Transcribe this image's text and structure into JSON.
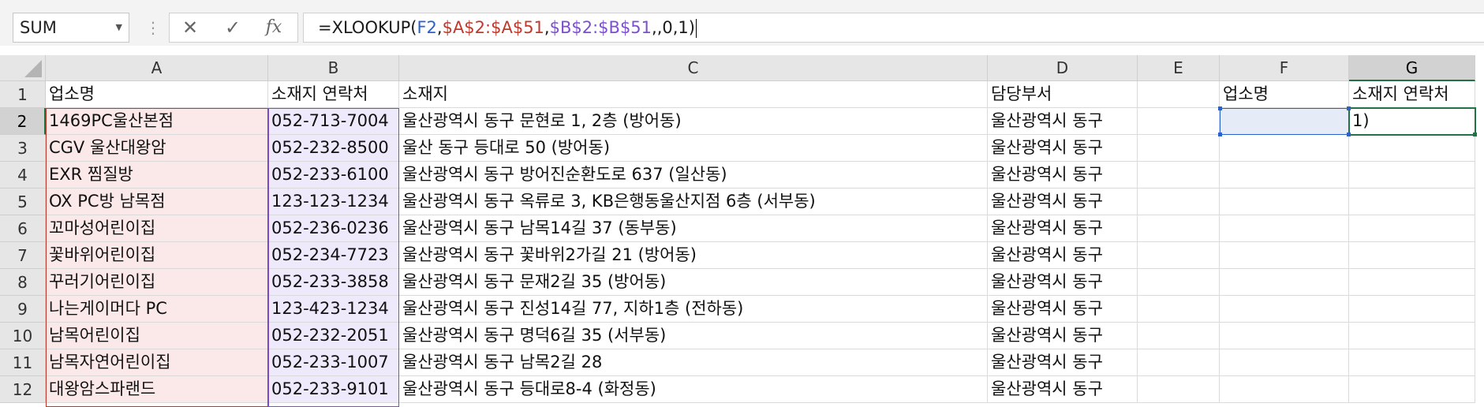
{
  "formula_bar": {
    "name_box": "SUM",
    "cancel_icon": "✕",
    "enter_icon": "✓",
    "fx_label": "fx",
    "formula_parts": [
      {
        "text": "=XLOOKUP(",
        "color": "#1a1a1a"
      },
      {
        "text": "F2",
        "color": "#2a62c9"
      },
      {
        "text": ",",
        "color": "#1a1a1a"
      },
      {
        "text": "$A$2:$A$51",
        "color": "#c0392b"
      },
      {
        "text": ",",
        "color": "#1a1a1a"
      },
      {
        "text": "$B$2:$B$51",
        "color": "#7d4fd0"
      },
      {
        "text": ",,0,1)",
        "color": "#1a1a1a"
      }
    ]
  },
  "columns": [
    "A",
    "B",
    "C",
    "D",
    "E",
    "F",
    "G"
  ],
  "selected_column": "G",
  "rows": [
    {
      "num": "1",
      "A": "업소명",
      "B": "소재지 연락처",
      "C": "소재지",
      "D": "담당부서",
      "E": "",
      "F": "업소명",
      "G": "소재지 연락처"
    },
    {
      "num": "2",
      "A": "1469PC울산본점",
      "B": "052-713-7004",
      "C": "울산광역시 동구 문현로 1, 2층 (방어동)",
      "D": "울산광역시 동구",
      "E": "",
      "F": "",
      "G": "1)"
    },
    {
      "num": "3",
      "A": "CGV 울산대왕암",
      "B": "052-232-8500",
      "C": "울산 동구 등대로 50 (방어동)",
      "D": "울산광역시 동구",
      "E": "",
      "F": "",
      "G": ""
    },
    {
      "num": "4",
      "A": "EXR 찜질방",
      "B": "052-233-6100",
      "C": "울산광역시 동구 방어진순환도로 637 (일산동)",
      "D": "울산광역시 동구",
      "E": "",
      "F": "",
      "G": ""
    },
    {
      "num": "5",
      "A": "OX PC방 남목점",
      "B": "123-123-1234",
      "C": "울산광역시 동구 옥류로 3, KB은행동울산지점 6층 (서부동)",
      "D": "울산광역시 동구",
      "E": "",
      "F": "",
      "G": ""
    },
    {
      "num": "6",
      "A": "꼬마성어린이집",
      "B": "052-236-0236",
      "C": "울산광역시 동구 남목14길 37 (동부동)",
      "D": "울산광역시 동구",
      "E": "",
      "F": "",
      "G": ""
    },
    {
      "num": "7",
      "A": "꽃바위어린이집",
      "B": "052-234-7723",
      "C": "울산광역시 동구 꽃바위2가길 21 (방어동)",
      "D": "울산광역시 동구",
      "E": "",
      "F": "",
      "G": ""
    },
    {
      "num": "8",
      "A": "꾸러기어린이집",
      "B": "052-233-3858",
      "C": "울산광역시 동구  문재2길 35 (방어동)",
      "D": "울산광역시 동구",
      "E": "",
      "F": "",
      "G": ""
    },
    {
      "num": "9",
      "A": "나는게이머다 PC",
      "B": "123-423-1234",
      "C": "울산광역시 동구 진성14길 77, 지하1층 (전하동)",
      "D": "울산광역시 동구",
      "E": "",
      "F": "",
      "G": ""
    },
    {
      "num": "10",
      "A": "남목어린이집",
      "B": "052-232-2051",
      "C": "울산광역시 동구  명덕6길 35 (서부동)",
      "D": "울산광역시 동구",
      "E": "",
      "F": "",
      "G": ""
    },
    {
      "num": "11",
      "A": "남목자연어린이집",
      "B": "052-233-1007",
      "C": "울산광역시 동구 남목2길 28",
      "D": "울산광역시 동구",
      "E": "",
      "F": "",
      "G": ""
    },
    {
      "num": "12",
      "A": "대왕암스파랜드",
      "B": "052-233-9101",
      "C": "울산광역시 동구 등대로8-4 (화정동)",
      "D": "울산광역시 동구",
      "E": "",
      "F": "",
      "G": ""
    }
  ]
}
